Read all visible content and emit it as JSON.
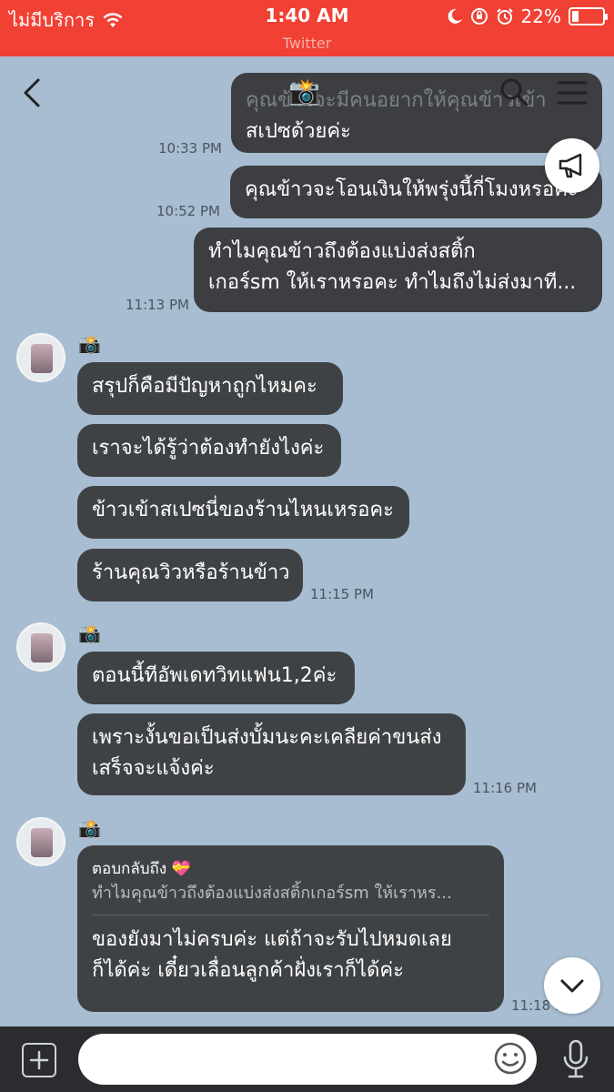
{
  "status": {
    "carrier": "ไม่มีบริการ",
    "time": "1:40 AM",
    "battery": "22%",
    "battery_level": 0.22,
    "sub": "Twitter"
  },
  "nav": {
    "title_emoji": "📸",
    "icons": [
      "back-icon",
      "search-icon",
      "menu-icon"
    ]
  },
  "messages": {
    "me1_text": "สเปซด้วยค่ะ",
    "me1_partial": "คุณข้าวจะมีคนอยากให้คุณข้าวเข้า",
    "me1_time": "10:33 PM",
    "me2_text": "คุณข้าวจะโอนเงินให้พรุ่งนี้กี่โมงหรอคะ",
    "me2_time": "10:52 PM",
    "me3_line1": "ทำไมคุณข้าวถึงต้องแบ่งส่งสติ้ก",
    "me3_line2": "เกอร์sm ให้เราหรอคะ ทำไมถึงไม่ส่งมาที...",
    "me3_time": "11:13 PM",
    "sender_emoji": "📸",
    "g1": [
      "สรุปก็คือมีปัญหาถูกไหมคะ",
      "เราจะได้รู้ว่าต้องทำยังไงค่ะ",
      "ข้าวเข้าสเปซนี่ของร้านไหนเหรอคะ",
      "ร้านคุณวิวหรือร้านข้าว"
    ],
    "g1_time": "11:15 PM",
    "g2_1": "ตอนนี้ทีอัพเดทวิทแฟน1,2ค่ะ",
    "g2_2_line1": "เพราะงั้นขอเป็นส่งบั้มนะคะเคลียค่าขนส่ง",
    "g2_2_line2": "เสร็จจะแจ้งค่ะ",
    "g2_time": "11:16 PM",
    "reply_head": "ตอบกลับถึง 💝",
    "reply_quote": "ทำไมคุณข้าวถึงต้องแบ่งส่งสติ้กเกอร์sm ให้เราหร...",
    "reply_line1": "ของยังมาไม่ครบค่ะ แต่ถ้าจะรับไปหมดเลย",
    "reply_line2": "ก็ได้ค่ะ เดี๋ยวเลื่อนลูกค้าฝั่งเราก็ได้ค่ะ",
    "reply_time": "11:18 PM"
  },
  "input": {
    "placeholder": ""
  }
}
